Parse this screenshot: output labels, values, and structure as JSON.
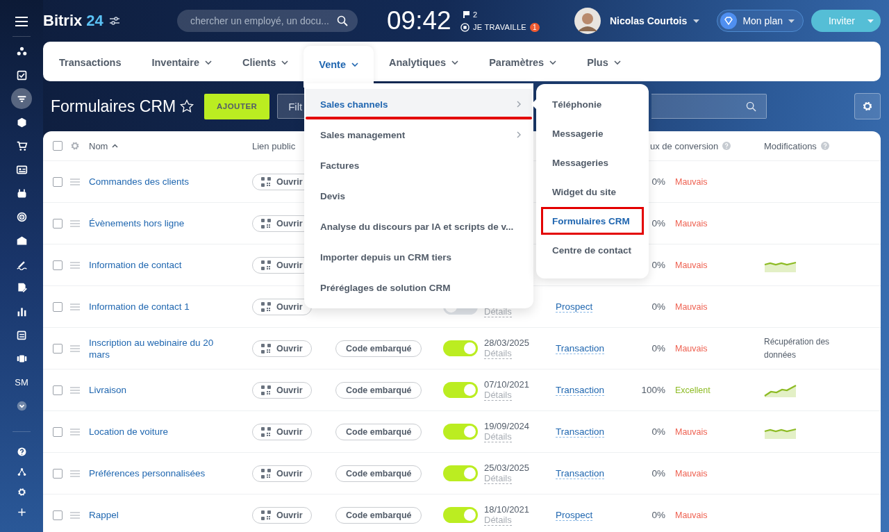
{
  "sidebar": {
    "items": [
      {
        "selected": false
      },
      {
        "selected": false
      },
      {
        "selected": true
      },
      {
        "selected": false
      },
      {
        "selected": false
      },
      {
        "selected": false
      },
      {
        "selected": false
      },
      {
        "selected": false
      },
      {
        "selected": false
      },
      {
        "selected": false
      },
      {
        "selected": false
      },
      {
        "selected": false
      },
      {
        "selected": false
      },
      {
        "selected": false
      },
      {
        "label": "SM",
        "selected": false
      },
      {
        "selected": false
      }
    ]
  },
  "header": {
    "logo": {
      "name": "Bitrix",
      "number": "24"
    },
    "search": {
      "placeholder": "chercher un employé, un docu..."
    },
    "clock": "09:42",
    "flag_count": "2",
    "work_status": "JE TRAVAILLE",
    "work_badge": "1",
    "user": {
      "name": "Nicolas Courtois"
    },
    "plan_button": "Mon plan",
    "invite_button": "Inviter"
  },
  "nav": {
    "tabs": [
      {
        "label": "Transactions",
        "dropdown": false,
        "selected": false
      },
      {
        "label": "Inventaire",
        "dropdown": true,
        "selected": false
      },
      {
        "label": "Clients",
        "dropdown": true,
        "selected": false
      },
      {
        "label": "Vente",
        "dropdown": true,
        "selected": true
      },
      {
        "label": "Analytiques",
        "dropdown": true,
        "selected": false
      },
      {
        "label": "Paramètres",
        "dropdown": true,
        "selected": false
      },
      {
        "label": "Plus",
        "dropdown": true,
        "selected": false
      }
    ]
  },
  "menu": {
    "items": [
      {
        "label": "Sales channels",
        "submenu": true,
        "selected": true,
        "underlined": true
      },
      {
        "label": "Sales management",
        "submenu": true,
        "selected": false,
        "underlined": false
      },
      {
        "label": "Factures",
        "submenu": false,
        "selected": false,
        "underlined": false
      },
      {
        "label": "Devis",
        "submenu": false,
        "selected": false,
        "underlined": false
      },
      {
        "label": "Analyse du discours par IA et scripts de v...",
        "submenu": false,
        "selected": false,
        "underlined": false
      },
      {
        "label": "Importer depuis un CRM tiers",
        "submenu": false,
        "selected": false,
        "underlined": false
      },
      {
        "label": "Préréglages de solution CRM",
        "submenu": false,
        "selected": false,
        "underlined": false
      }
    ]
  },
  "submenu": {
    "items": [
      {
        "label": "Téléphonie",
        "selected": false,
        "boxed": false
      },
      {
        "label": "Messagerie",
        "selected": false,
        "boxed": false
      },
      {
        "label": "Messageries",
        "selected": false,
        "boxed": false
      },
      {
        "label": "Widget du site",
        "selected": false,
        "boxed": false
      },
      {
        "label": "Formulaires CRM",
        "selected": true,
        "boxed": true
      },
      {
        "label": "Centre de contact",
        "selected": false,
        "boxed": false
      }
    ]
  },
  "page": {
    "title": "Formulaires CRM",
    "favorite": false,
    "add_button": "AJOUTER",
    "filter": {
      "placeholder": "Filt"
    }
  },
  "table": {
    "select_all": {
      "checked": false
    },
    "columns": [
      {
        "label": "Nom",
        "sorted": true,
        "help": false
      },
      {
        "label": "Lien public",
        "sorted": false,
        "help": false
      },
      {
        "label": "ux de conversion",
        "sorted": false,
        "help": true
      },
      {
        "label": "Modifications",
        "sorted": false,
        "help": true
      }
    ],
    "rows": [
      {
        "checked": false,
        "name": "Commandes des clients",
        "open_button": "Ouvrir",
        "conversion": "0%",
        "rating": {
          "text": "Mauvais",
          "color": "#ee5f4f"
        }
      },
      {
        "checked": false,
        "name": "Évènements hors ligne",
        "open_button": "Ouvrir",
        "conversion": "0%",
        "rating": {
          "text": "Mauvais",
          "color": "#ee5f4f"
        }
      },
      {
        "checked": false,
        "name": "Information de contact",
        "open_button": "Ouvrir",
        "conversion": "0%",
        "rating": {
          "text": "Mauvais",
          "color": "#ee5f4f"
        },
        "sparkline": {
          "kind": "wavy"
        }
      },
      {
        "checked": false,
        "name": "Information de contact 1",
        "open_button": "Ouvrir",
        "active": false,
        "details": "Détails",
        "entity": "Prospect",
        "conversion": "0%",
        "rating": {
          "text": "Mauvais",
          "color": "#ee5f4f"
        }
      },
      {
        "checked": false,
        "name": "Inscription au webinaire du 20 mars",
        "open_button": "Ouvrir",
        "code_button": "Code embarqué",
        "active": true,
        "date": "28/03/2025",
        "details": "Détails",
        "entity": "Transaction",
        "conversion": "0%",
        "rating": {
          "text": "Mauvais",
          "color": "#ee5f4f"
        },
        "modification": "Récupération des données"
      },
      {
        "checked": false,
        "name": "Livraison",
        "open_button": "Ouvrir",
        "code_button": "Code embarqué",
        "active": true,
        "date": "07/10/2021",
        "details": "Détails",
        "entity": "Transaction",
        "conversion": "100%",
        "rating": {
          "text": "Excellent",
          "color": "#8dbb24"
        },
        "sparkline": {
          "kind": "rising"
        }
      },
      {
        "checked": false,
        "name": "Location de voiture",
        "open_button": "Ouvrir",
        "code_button": "Code embarqué",
        "active": true,
        "date": "19/09/2024",
        "details": "Détails",
        "entity": "Transaction",
        "conversion": "0%",
        "rating": {
          "text": "Mauvais",
          "color": "#ee5f4f"
        },
        "sparkline": {
          "kind": "wavy"
        }
      },
      {
        "checked": false,
        "name": "Préférences personnalisées",
        "open_button": "Ouvrir",
        "code_button": "Code embarqué",
        "active": true,
        "date": "25/03/2025",
        "details": "Détails",
        "entity": "Transaction",
        "conversion": "0%",
        "rating": {
          "text": "Mauvais",
          "color": "#ee5f4f"
        }
      },
      {
        "checked": false,
        "name": "Rappel",
        "open_button": "Ouvrir",
        "code_button": "Code embarqué",
        "active": true,
        "date": "18/10/2021",
        "details": "Détails",
        "entity": "Prospect",
        "conversion": "0%",
        "rating": {
          "text": "Mauvais",
          "color": "#ee5f4f"
        }
      }
    ]
  }
}
